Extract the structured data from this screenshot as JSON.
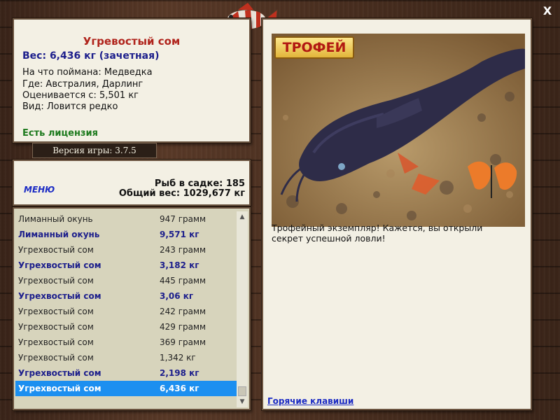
{
  "window": {
    "close_label": "X"
  },
  "fish": {
    "title": "Угревостый сом",
    "weight": "Вес: 6,436 кг (зачетная)",
    "caught_with": "На что поймана: Медведка",
    "location": "Где: Австралия, Дарлинг",
    "valued_from": "Оценивается с: 5,501 кг",
    "rarity": "Вид: Ловится редко",
    "license": "Есть лицензия"
  },
  "version": "Версия игры: 3.7.5",
  "stats": {
    "menu_label": "МЕНЮ",
    "fish_count": "Рыб в садке: 185",
    "total_weight": "Общий вес: 1029,677 кг"
  },
  "catch_list": [
    {
      "name": "Лиманный окунь",
      "weight": "947 грамм",
      "bold": false
    },
    {
      "name": "Лиманный окунь",
      "weight": "9,571 кг",
      "bold": true
    },
    {
      "name": "Угрехвостый сом",
      "weight": "243 грамм",
      "bold": false
    },
    {
      "name": "Угрехвостый сом",
      "weight": "3,182 кг",
      "bold": true
    },
    {
      "name": "Угрехвостый сом",
      "weight": "445 грамм",
      "bold": false
    },
    {
      "name": "Угрехвостый сом",
      "weight": "3,06 кг",
      "bold": true
    },
    {
      "name": "Угрехвостый сом",
      "weight": "242 грамм",
      "bold": false
    },
    {
      "name": "Угрехвостый сом",
      "weight": "429 грамм",
      "bold": false
    },
    {
      "name": "Угрехвостый сом",
      "weight": "369 грамм",
      "bold": false
    },
    {
      "name": "Угрехвостый сом",
      "weight": "1,342 кг",
      "bold": false
    },
    {
      "name": "Угрехвостый сом",
      "weight": "2,198 кг",
      "bold": true
    },
    {
      "name": "Угрехвостый сом",
      "weight": "6,436 кг",
      "bold": true,
      "selected": true
    }
  ],
  "trophy": {
    "badge": "ТРОФЕЙ",
    "description": "Трофейный экземпляр! Кажется, вы открыли секрет успешной ловли!"
  },
  "footer": {
    "hotkeys_label": "Горячие клавиши"
  },
  "icons": {
    "close": "close-icon",
    "scroll_up": "chevron-up-icon",
    "scroll_down": "chevron-down-icon"
  },
  "colors": {
    "title_red": "#b0241c",
    "weight_blue": "#1d1f8c",
    "license_green": "#1d7a1d",
    "selection_blue": "#1c8ff0"
  }
}
